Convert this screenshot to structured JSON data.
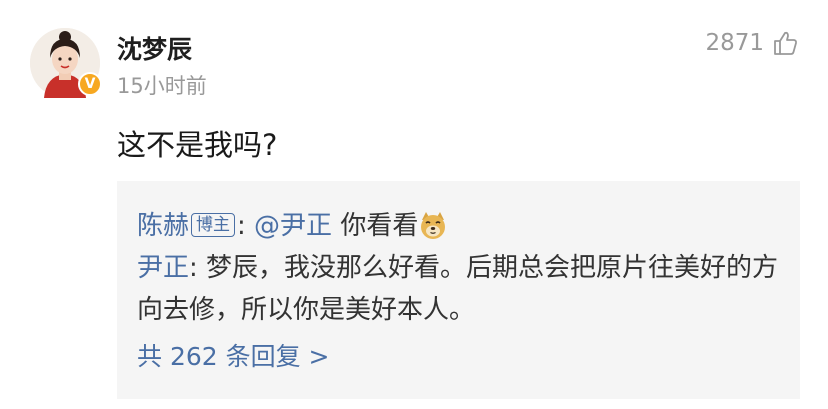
{
  "comment": {
    "username": "沈梦辰",
    "time": "15小时前",
    "like_count": "2871",
    "text": "这不是我吗?"
  },
  "replies": {
    "first": {
      "author": "陈赫",
      "badge": "博主",
      "colon": ":",
      "mention": "@尹正",
      "text": " 你看看"
    },
    "second": {
      "author": "尹正",
      "colon": ": ",
      "text": "梦辰，我没那么好看。后期总会把原片往美好的方向去修，所以你是美好本人。"
    },
    "more_label": "共 262 条回复 >"
  },
  "colors": {
    "link": "#4a6fa5",
    "muted": "#999999",
    "reply_bg": "#f5f5f5",
    "verified_badge": "#f7a821"
  },
  "icons": {
    "like": "thumbs-up-icon",
    "emoji": "doge-emoji-icon",
    "verified": "verified-badge-icon"
  }
}
